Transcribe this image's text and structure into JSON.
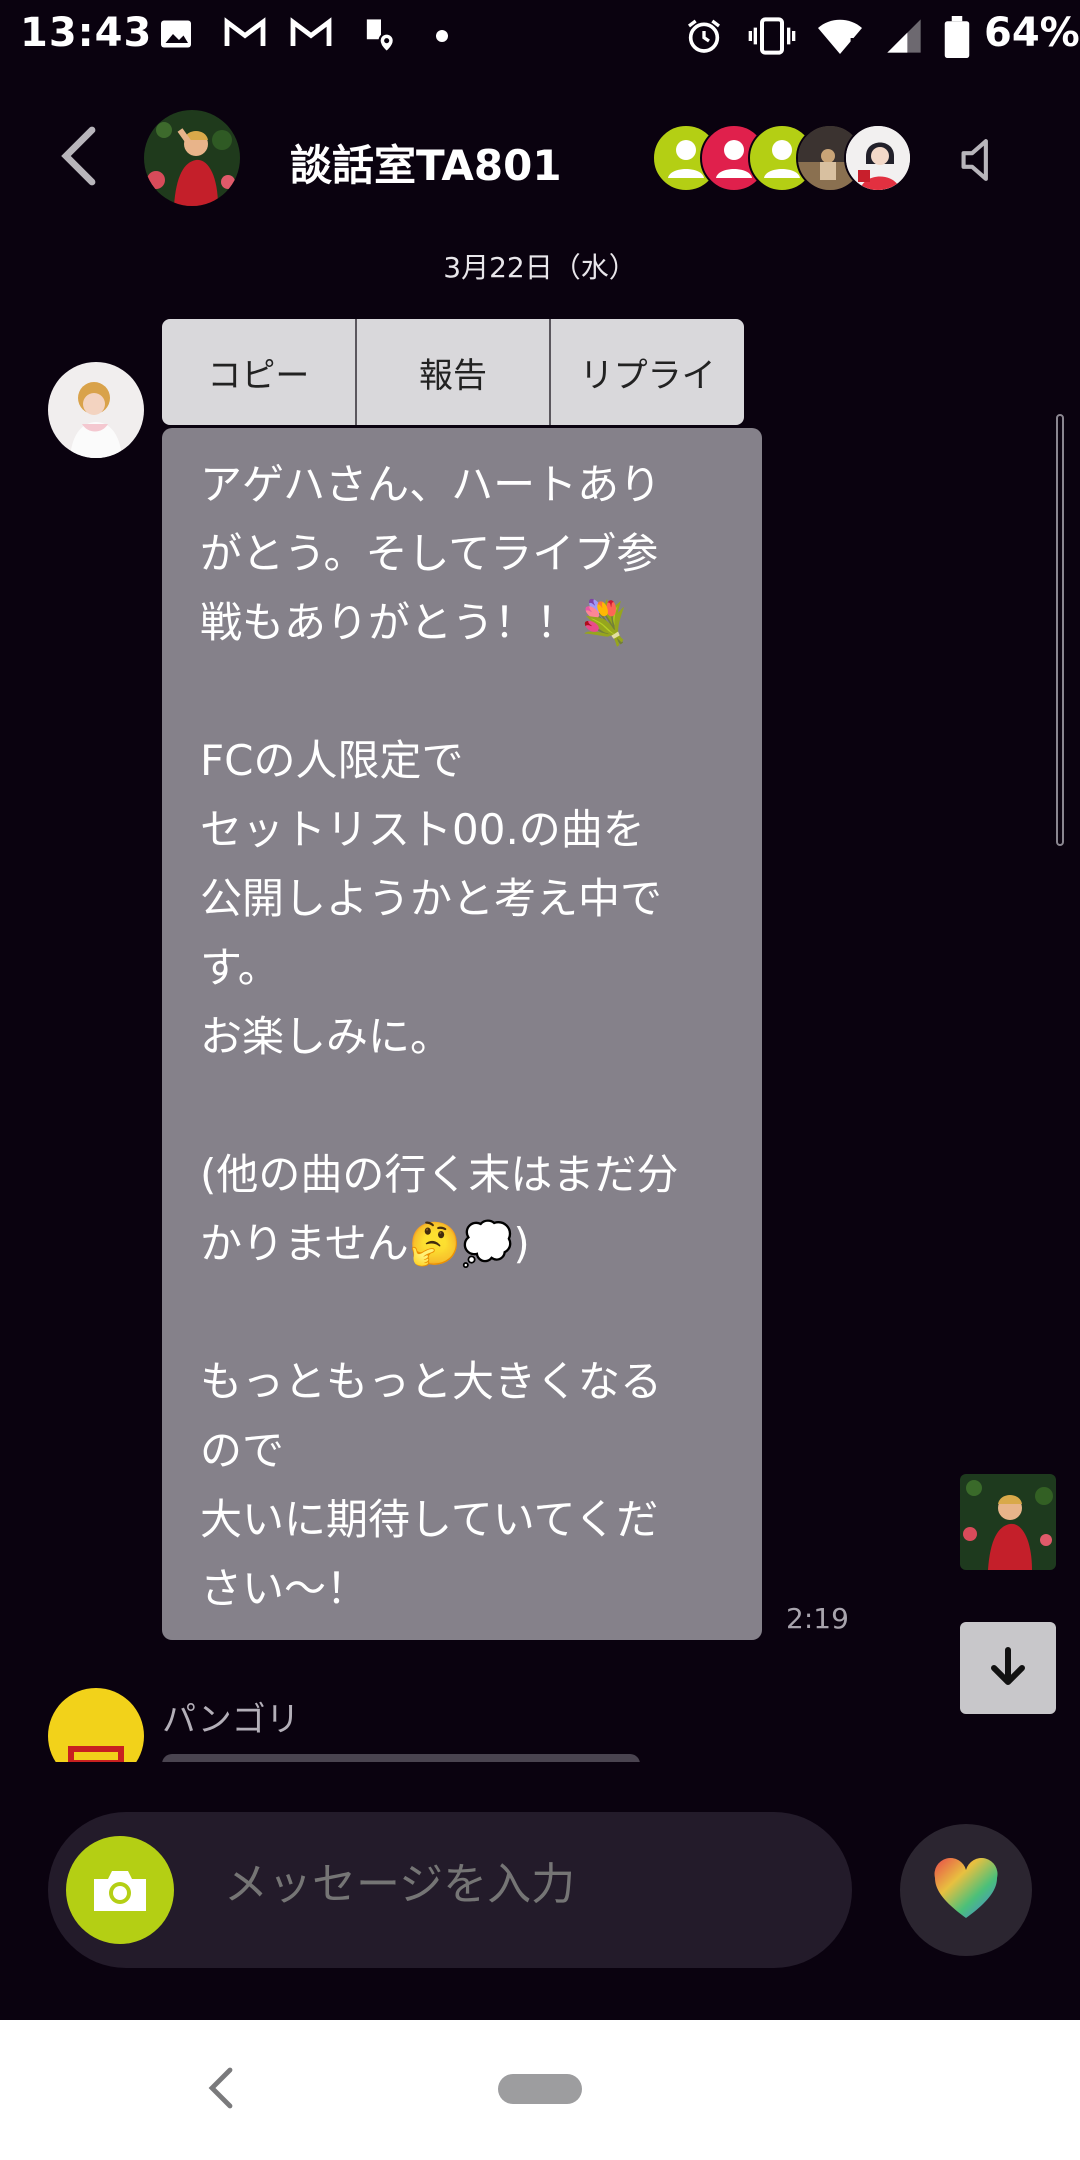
{
  "status_bar": {
    "time": "13:43",
    "battery": "64%",
    "icons": [
      "image-icon",
      "gmail-icon",
      "gmail-icon",
      "location-icon",
      "dot-icon",
      "alarm-icon",
      "vibrate-icon",
      "wifi-icon",
      "signal-icon",
      "battery-icon"
    ]
  },
  "header": {
    "title": "談話室TA801",
    "back_icon": "chevron-left-icon",
    "mute_icon": "speaker-muted-icon",
    "members": [
      "member-avatar",
      "member-avatar",
      "member-avatar",
      "member-avatar",
      "member-avatar"
    ]
  },
  "chat": {
    "date": "3月22日（水）",
    "context_menu": [
      "コピー",
      "報告",
      "リプライ"
    ],
    "message": {
      "lines": [
        "アゲハさん、ハートあり",
        "がとう。そしてライブ参",
        "戦もありがとう！！💐",
        "",
        "FCの人限定で",
        "セットリスト00.の曲を",
        "公開しようかと考え中で",
        "す。",
        "お楽しみに。",
        "",
        "(他の曲の行く末はまだ分",
        "かりません🤔💭)",
        "",
        "もっともっと大きくなる",
        "ので",
        "大いに期待していてくだ",
        "さい〜！"
      ],
      "time": "2:19"
    },
    "next_sender": "パンゴリ"
  },
  "input": {
    "placeholder": "メッセージを入力"
  },
  "colors": {
    "background": "#0a020f",
    "bubble": "#85818a",
    "camera": "#b4cf14"
  }
}
